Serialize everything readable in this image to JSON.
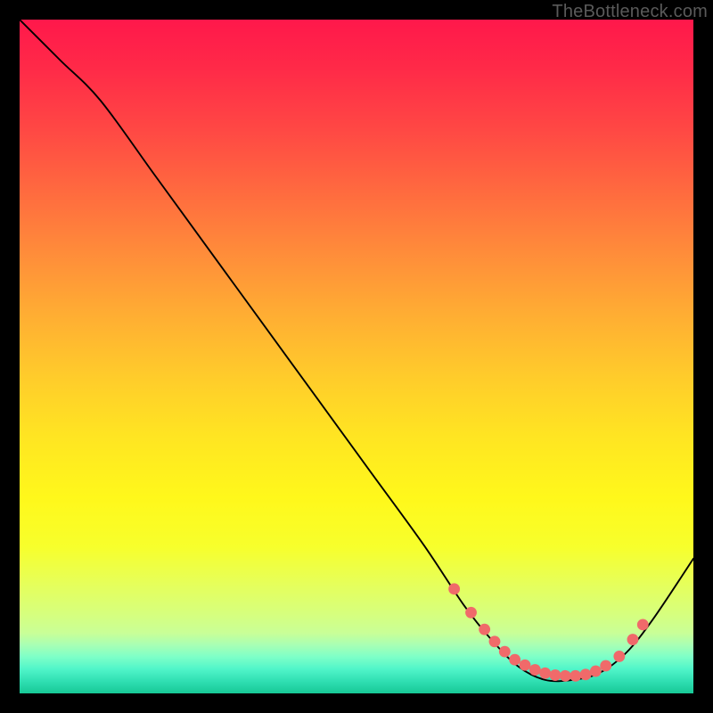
{
  "watermark": "TheBottleneck.com",
  "chart_data": {
    "type": "line",
    "title": "",
    "xlabel": "",
    "ylabel": "",
    "xlim": [
      0,
      100
    ],
    "ylim": [
      0,
      100
    ],
    "grid": false,
    "legend": false,
    "series": [
      {
        "name": "curve",
        "x": [
          0,
          6,
          12,
          20,
          28,
          36,
          44,
          52,
          60,
          66,
          70,
          74,
          78,
          82,
          86,
          90,
          94,
          100
        ],
        "y": [
          100,
          94,
          88,
          77,
          66,
          55,
          44,
          33,
          22,
          13,
          8,
          4,
          2,
          2,
          3,
          6,
          11,
          20
        ]
      }
    ],
    "markers": {
      "name": "emphasis-points",
      "color": "#f06a6a",
      "x": [
        64.5,
        67,
        69,
        70.5,
        72,
        73.5,
        75,
        76.5,
        78,
        79.5,
        81,
        82.5,
        84,
        85.5,
        87,
        89,
        91,
        92.5
      ],
      "y": [
        15.5,
        12,
        9.5,
        7.7,
        6.2,
        5.0,
        4.2,
        3.5,
        3.0,
        2.7,
        2.6,
        2.6,
        2.8,
        3.3,
        4.1,
        5.5,
        8.0,
        10.2
      ]
    },
    "background_gradient": {
      "type": "vertical",
      "stops": [
        {
          "pos": 0.0,
          "color": "#ff184b"
        },
        {
          "pos": 0.35,
          "color": "#ff8c3a"
        },
        {
          "pos": 0.65,
          "color": "#ffe522"
        },
        {
          "pos": 0.88,
          "color": "#d6ff7e"
        },
        {
          "pos": 1.0,
          "color": "#17c896"
        }
      ]
    }
  }
}
